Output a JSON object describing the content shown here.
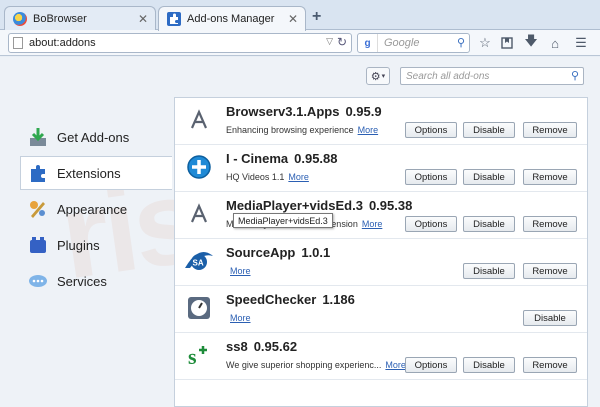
{
  "tabs": [
    {
      "title": "BoBrowser",
      "active": false
    },
    {
      "title": "Add-ons Manager",
      "active": true
    }
  ],
  "new_tab_label": "+",
  "navbar": {
    "url": "about:addons",
    "search_placeholder": "Google",
    "search_engine_glyph": "g"
  },
  "addons_toolbar": {
    "search_placeholder": "Search all add-ons"
  },
  "sidebar": {
    "items": [
      {
        "label": "Get Add-ons",
        "icon": "get-addons-icon"
      },
      {
        "label": "Extensions",
        "icon": "puzzle-icon",
        "selected": true
      },
      {
        "label": "Appearance",
        "icon": "appearance-icon"
      },
      {
        "label": "Plugins",
        "icon": "plugins-icon"
      },
      {
        "label": "Services",
        "icon": "services-icon"
      }
    ]
  },
  "extensions": [
    {
      "name": "Browserv3.1.Apps",
      "version": "0.95.9",
      "description": "Enhancing browsing experience",
      "more": "More",
      "buttons": [
        "Options",
        "Disable",
        "Remove"
      ],
      "icon": "generic-addon-icon"
    },
    {
      "name": "I - Cinema",
      "version": "0.95.88",
      "description": "HQ Videos 1.1",
      "more": "More",
      "buttons": [
        "Options",
        "Disable",
        "Remove"
      ],
      "icon": "plus-circle-icon"
    },
    {
      "name": "MediaPlayer+vidsEd.3",
      "version": "0.95.38",
      "description": "MediaPlayer+vidsEd.3 Extension",
      "more": "More",
      "buttons": [
        "Options",
        "Disable",
        "Remove"
      ],
      "icon": "generic-addon-icon"
    },
    {
      "name": "SourceApp",
      "version": "1.0.1",
      "description": "",
      "more": "More",
      "buttons": [
        "Disable",
        "Remove"
      ],
      "icon": "sa-logo-icon"
    },
    {
      "name": "SpeedChecker",
      "version": "1.186",
      "description": "",
      "more": "More",
      "buttons": [
        "Disable"
      ],
      "icon": "speedometer-icon"
    },
    {
      "name": "ss8",
      "version": "0.95.62",
      "description": "We give superior shopping experienc...",
      "more": "More",
      "buttons": [
        "Options",
        "Disable",
        "Remove"
      ],
      "icon": "ss8-logo-icon"
    }
  ],
  "tooltip": "MediaPlayer+vidsEd.3",
  "watermark": "risk.com",
  "colors": {
    "link": "#2b5fb3",
    "selected_bg": "#ffffff",
    "chrome_bg": "#d9e4f1"
  }
}
